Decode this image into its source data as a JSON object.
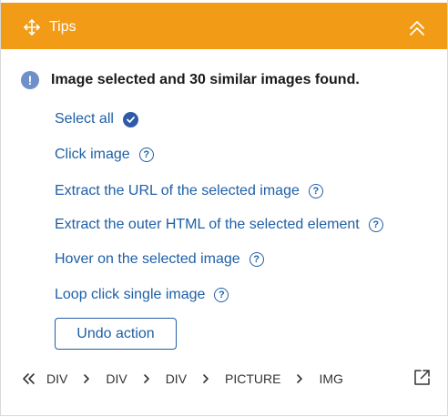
{
  "header": {
    "title": "Tips"
  },
  "message": "Image selected and 30 similar images found.",
  "actions": [
    {
      "label": "Select all",
      "icon": "check-icon"
    },
    {
      "label": "Click image",
      "icon": "help-icon"
    },
    {
      "label": "Extract the URL of the selected image",
      "icon": "help-icon"
    },
    {
      "label": "Extract the outer HTML of the selected element",
      "icon": "help-icon"
    },
    {
      "label": "Hover on the selected image",
      "icon": "help-icon"
    },
    {
      "label": "Loop click single image",
      "icon": "help-icon"
    }
  ],
  "undo_label": "Undo action",
  "breadcrumb": [
    "DIV",
    "DIV",
    "DIV",
    "PICTURE",
    "IMG"
  ],
  "colors": {
    "header": "#f29b16",
    "link": "#1f5fa6",
    "info": "#6f8fc9"
  }
}
